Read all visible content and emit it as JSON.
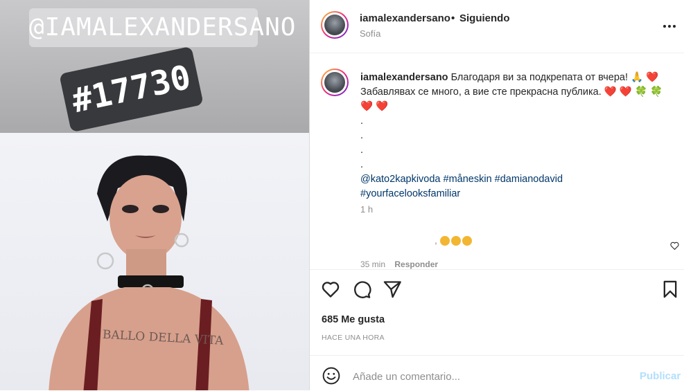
{
  "media": {
    "sticker_handle": "@IAMALEXANDERSANO",
    "sticker_tag": "#17730",
    "tattoo_text": "BALLO DELLA VITA"
  },
  "header": {
    "username": "iamalexandersano",
    "separator": "•",
    "follow_status": "Siguiendo",
    "location": "Sofía"
  },
  "caption": {
    "username": "iamalexandersano",
    "line1": "Благодаря ви за подкрепата от вчера! 🙏 ❤️",
    "line2": "Забавлявах се много, а вие сте прекрасна публика. ❤️ ❤️ 🍀 🍀",
    "line3": "❤️ ❤️",
    "dots": [
      ".",
      ".",
      ".",
      "."
    ],
    "mention": "@kato2kapkivoda",
    "tag1": "#måneskin",
    "tag2": "#damianodavid",
    "tag3": "#yourfacelooksfamiliar",
    "time": "1 h"
  },
  "comment": {
    "meta_time": "35 min",
    "reply": "Responder"
  },
  "footer": {
    "likes": "685 Me gusta",
    "posted": "HACE UNA HORA",
    "comment_placeholder": "Añade un comentario...",
    "publish": "Publicar"
  },
  "icons": {
    "more": "more-horizontal-icon",
    "like": "heart-icon",
    "comment": "comment-icon",
    "share": "share-icon",
    "save": "bookmark-icon",
    "emoji": "emoji-icon"
  },
  "colors": {
    "link": "#00376b",
    "secondary_text": "#8e8e8e",
    "publish_disabled": "#b2dffc"
  }
}
